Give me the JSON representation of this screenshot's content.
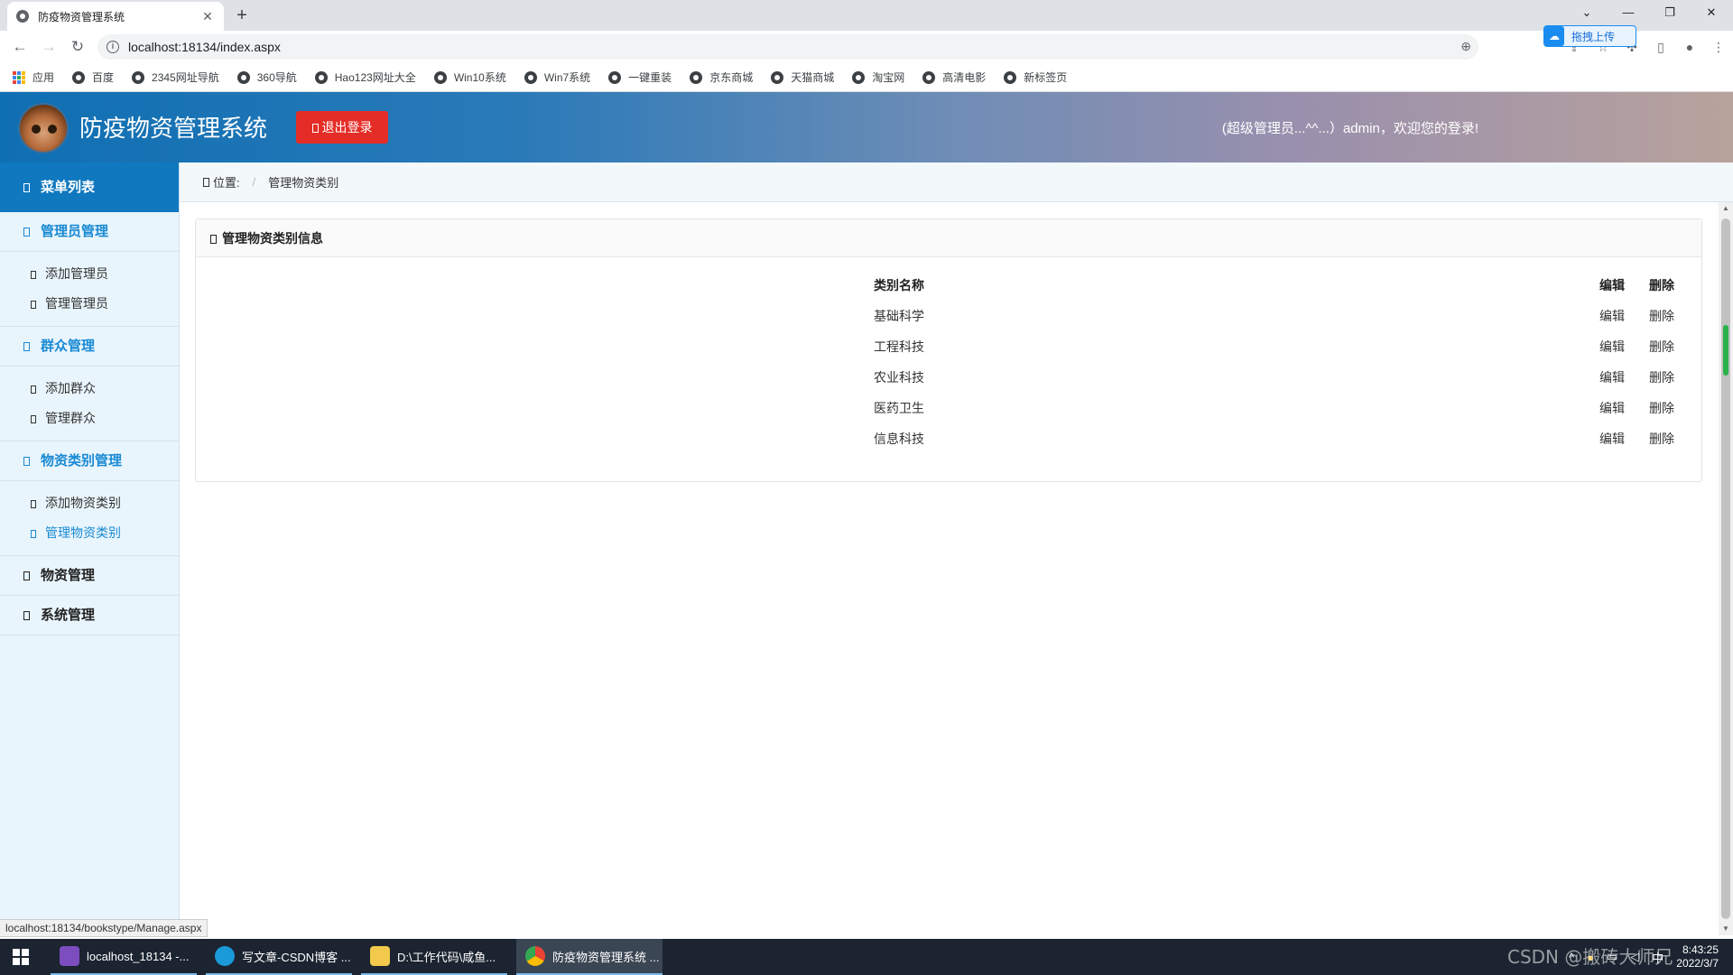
{
  "browser": {
    "tab_title": "防疫物资管理系统",
    "url": "localhost:18134/index.aspx",
    "upload_button": "拖拽上传",
    "bookmarks": [
      "应用",
      "百度",
      "2345网址导航",
      "360导航",
      "Hao123网址大全",
      "Win10系统",
      "Win7系统",
      "一键重装",
      "京东商城",
      "天猫商城",
      "淘宝网",
      "高清电影",
      "新标签页"
    ],
    "status_url": "localhost:18134/bookstype/Manage.aspx"
  },
  "header": {
    "title": "防疫物资管理系统",
    "logout_label": "退出登录",
    "welcome": "(超级管理员...^^...）admin，欢迎您的登录!"
  },
  "sidebar": {
    "heading": "菜单列表",
    "groups": [
      {
        "label": "管理员管理",
        "items": [
          "添加管理员",
          "管理管理员"
        ]
      },
      {
        "label": "群众管理",
        "items": [
          "添加群众",
          "管理群众"
        ]
      },
      {
        "label": "物资类别管理",
        "items": [
          "添加物资类别",
          "管理物资类别"
        ]
      },
      {
        "label": "物资管理",
        "items": []
      },
      {
        "label": "系统管理",
        "items": []
      }
    ],
    "active_item": "管理物资类别"
  },
  "breadcrumb": {
    "prefix": "位置:",
    "current": "管理物资类别"
  },
  "panel": {
    "title": "管理物资类别信息",
    "columns": [
      "类别名称",
      "编辑",
      "删除"
    ],
    "rows": [
      {
        "name": "基础科学",
        "edit": "编辑",
        "delete": "删除"
      },
      {
        "name": "工程科技",
        "edit": "编辑",
        "delete": "删除"
      },
      {
        "name": "农业科技",
        "edit": "编辑",
        "delete": "删除"
      },
      {
        "name": "医药卫生",
        "edit": "编辑",
        "delete": "删除"
      },
      {
        "name": "信息科技",
        "edit": "编辑",
        "delete": "删除"
      }
    ]
  },
  "taskbar": {
    "items": [
      "localhost_18134 -...",
      "写文章-CSDN博客 ...",
      "D:\\工作代码\\咸鱼...",
      "防疫物资管理系统 ..."
    ],
    "tray_lang": "中",
    "time": "8:43:25",
    "date": "2022/3/7",
    "watermark": "CSDN @搬砖大师兄"
  },
  "colors": {
    "accent": "#1a8ad4",
    "menu_head": "#1078bf",
    "logout": "#e52d27",
    "sidebar_bg": "#e9f5fc"
  }
}
